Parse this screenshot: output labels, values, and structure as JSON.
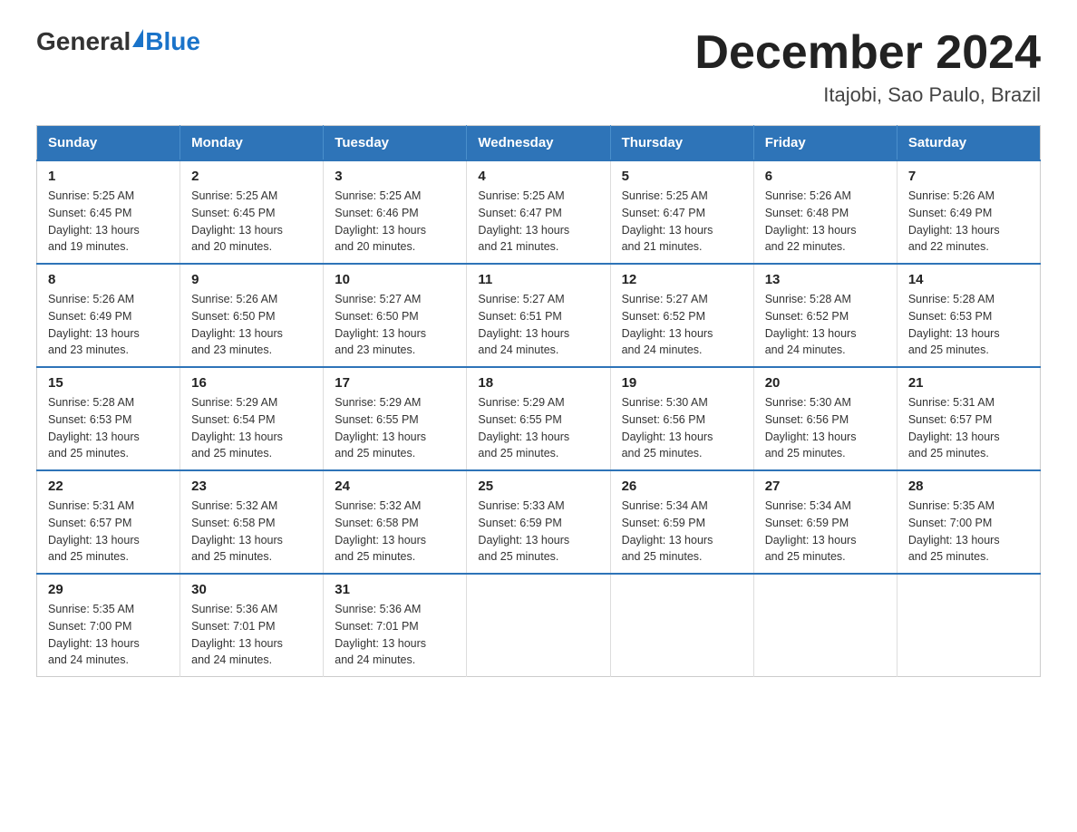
{
  "logo": {
    "general": "General",
    "blue": "Blue"
  },
  "title": "December 2024",
  "subtitle": "Itajobi, Sao Paulo, Brazil",
  "days_of_week": [
    "Sunday",
    "Monday",
    "Tuesday",
    "Wednesday",
    "Thursday",
    "Friday",
    "Saturday"
  ],
  "weeks": [
    [
      {
        "day": "1",
        "sunrise": "5:25 AM",
        "sunset": "6:45 PM",
        "daylight": "13 hours and 19 minutes."
      },
      {
        "day": "2",
        "sunrise": "5:25 AM",
        "sunset": "6:45 PM",
        "daylight": "13 hours and 20 minutes."
      },
      {
        "day": "3",
        "sunrise": "5:25 AM",
        "sunset": "6:46 PM",
        "daylight": "13 hours and 20 minutes."
      },
      {
        "day": "4",
        "sunrise": "5:25 AM",
        "sunset": "6:47 PM",
        "daylight": "13 hours and 21 minutes."
      },
      {
        "day": "5",
        "sunrise": "5:25 AM",
        "sunset": "6:47 PM",
        "daylight": "13 hours and 21 minutes."
      },
      {
        "day": "6",
        "sunrise": "5:26 AM",
        "sunset": "6:48 PM",
        "daylight": "13 hours and 22 minutes."
      },
      {
        "day": "7",
        "sunrise": "5:26 AM",
        "sunset": "6:49 PM",
        "daylight": "13 hours and 22 minutes."
      }
    ],
    [
      {
        "day": "8",
        "sunrise": "5:26 AM",
        "sunset": "6:49 PM",
        "daylight": "13 hours and 23 minutes."
      },
      {
        "day": "9",
        "sunrise": "5:26 AM",
        "sunset": "6:50 PM",
        "daylight": "13 hours and 23 minutes."
      },
      {
        "day": "10",
        "sunrise": "5:27 AM",
        "sunset": "6:50 PM",
        "daylight": "13 hours and 23 minutes."
      },
      {
        "day": "11",
        "sunrise": "5:27 AM",
        "sunset": "6:51 PM",
        "daylight": "13 hours and 24 minutes."
      },
      {
        "day": "12",
        "sunrise": "5:27 AM",
        "sunset": "6:52 PM",
        "daylight": "13 hours and 24 minutes."
      },
      {
        "day": "13",
        "sunrise": "5:28 AM",
        "sunset": "6:52 PM",
        "daylight": "13 hours and 24 minutes."
      },
      {
        "day": "14",
        "sunrise": "5:28 AM",
        "sunset": "6:53 PM",
        "daylight": "13 hours and 25 minutes."
      }
    ],
    [
      {
        "day": "15",
        "sunrise": "5:28 AM",
        "sunset": "6:53 PM",
        "daylight": "13 hours and 25 minutes."
      },
      {
        "day": "16",
        "sunrise": "5:29 AM",
        "sunset": "6:54 PM",
        "daylight": "13 hours and 25 minutes."
      },
      {
        "day": "17",
        "sunrise": "5:29 AM",
        "sunset": "6:55 PM",
        "daylight": "13 hours and 25 minutes."
      },
      {
        "day": "18",
        "sunrise": "5:29 AM",
        "sunset": "6:55 PM",
        "daylight": "13 hours and 25 minutes."
      },
      {
        "day": "19",
        "sunrise": "5:30 AM",
        "sunset": "6:56 PM",
        "daylight": "13 hours and 25 minutes."
      },
      {
        "day": "20",
        "sunrise": "5:30 AM",
        "sunset": "6:56 PM",
        "daylight": "13 hours and 25 minutes."
      },
      {
        "day": "21",
        "sunrise": "5:31 AM",
        "sunset": "6:57 PM",
        "daylight": "13 hours and 25 minutes."
      }
    ],
    [
      {
        "day": "22",
        "sunrise": "5:31 AM",
        "sunset": "6:57 PM",
        "daylight": "13 hours and 25 minutes."
      },
      {
        "day": "23",
        "sunrise": "5:32 AM",
        "sunset": "6:58 PM",
        "daylight": "13 hours and 25 minutes."
      },
      {
        "day": "24",
        "sunrise": "5:32 AM",
        "sunset": "6:58 PM",
        "daylight": "13 hours and 25 minutes."
      },
      {
        "day": "25",
        "sunrise": "5:33 AM",
        "sunset": "6:59 PM",
        "daylight": "13 hours and 25 minutes."
      },
      {
        "day": "26",
        "sunrise": "5:34 AM",
        "sunset": "6:59 PM",
        "daylight": "13 hours and 25 minutes."
      },
      {
        "day": "27",
        "sunrise": "5:34 AM",
        "sunset": "6:59 PM",
        "daylight": "13 hours and 25 minutes."
      },
      {
        "day": "28",
        "sunrise": "5:35 AM",
        "sunset": "7:00 PM",
        "daylight": "13 hours and 25 minutes."
      }
    ],
    [
      {
        "day": "29",
        "sunrise": "5:35 AM",
        "sunset": "7:00 PM",
        "daylight": "13 hours and 24 minutes."
      },
      {
        "day": "30",
        "sunrise": "5:36 AM",
        "sunset": "7:01 PM",
        "daylight": "13 hours and 24 minutes."
      },
      {
        "day": "31",
        "sunrise": "5:36 AM",
        "sunset": "7:01 PM",
        "daylight": "13 hours and 24 minutes."
      },
      null,
      null,
      null,
      null
    ]
  ],
  "labels": {
    "sunrise": "Sunrise:",
    "sunset": "Sunset:",
    "daylight": "Daylight:"
  }
}
